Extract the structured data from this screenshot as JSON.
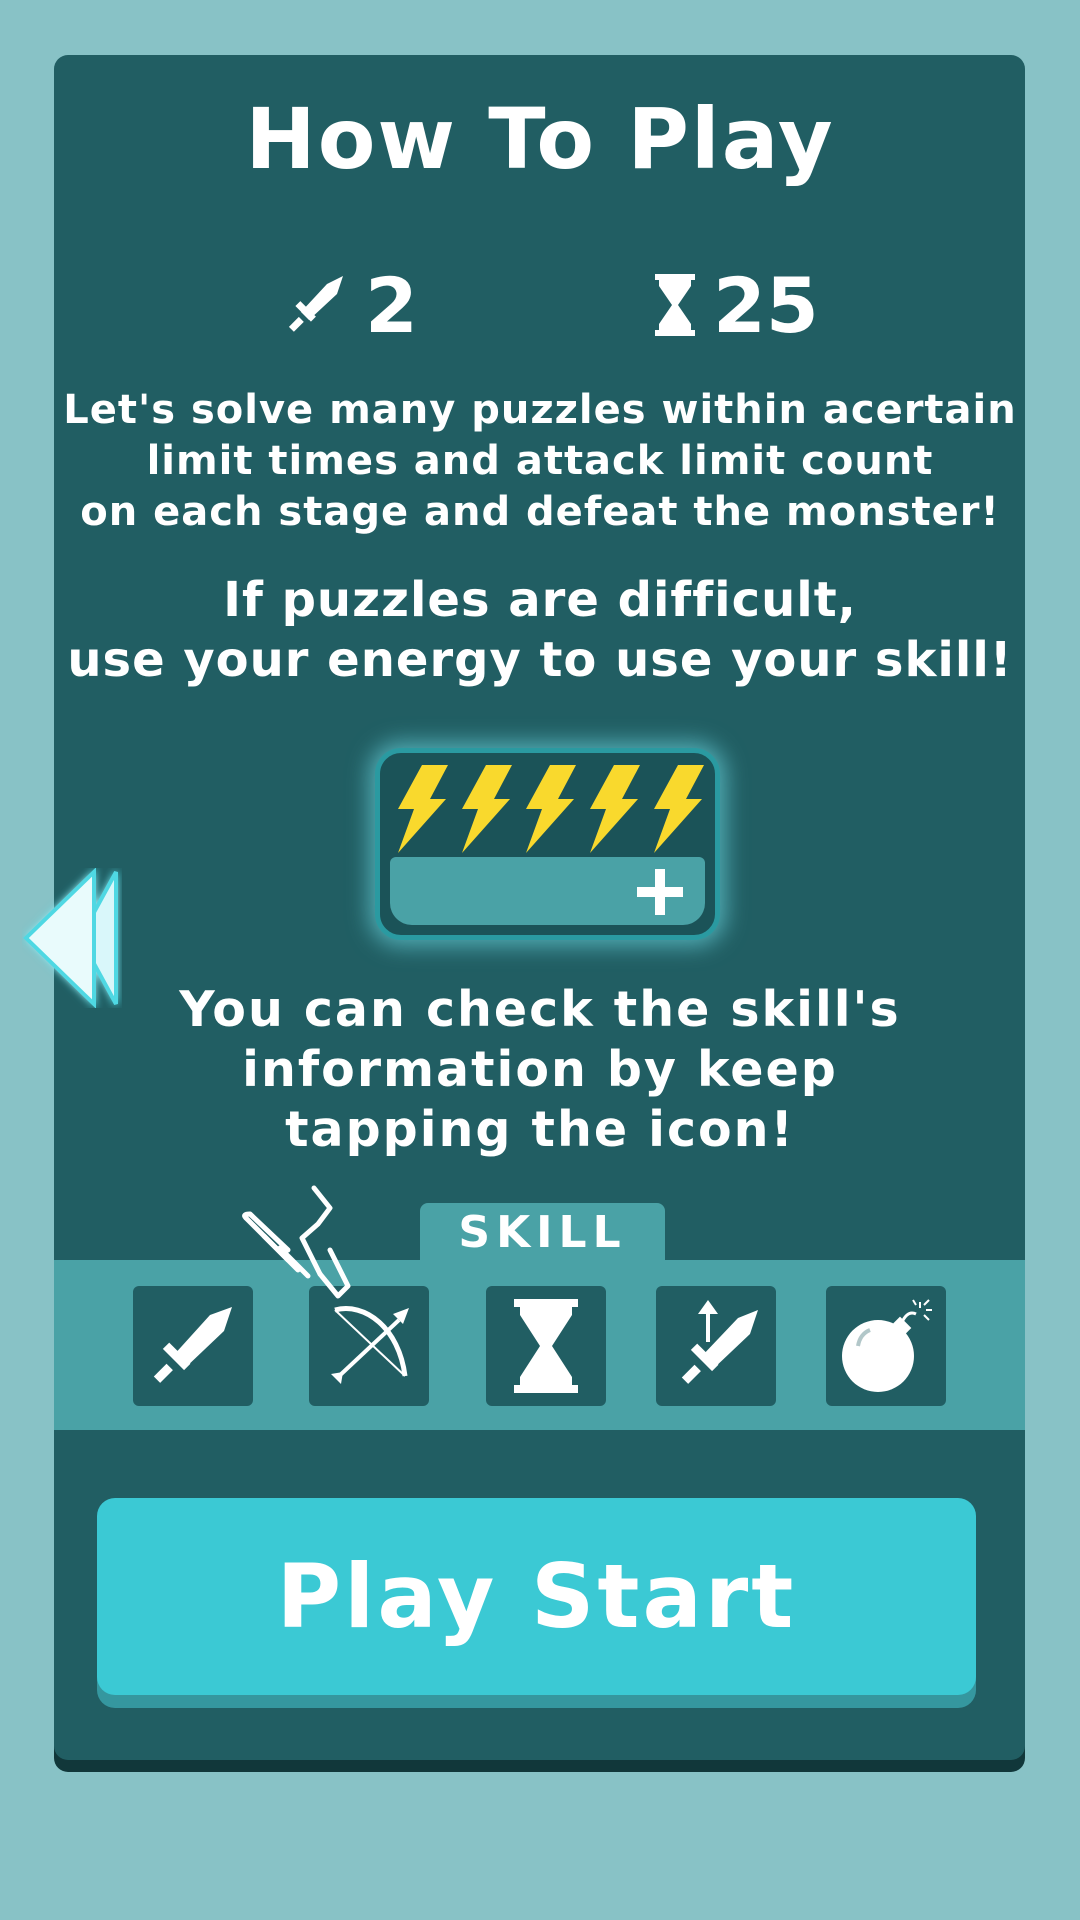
{
  "title": "How To Play",
  "stats": {
    "attack_count": "2",
    "time_limit": "25"
  },
  "text": {
    "rules_line1": "Let's solve many puzzles within acertain",
    "rules_line2": "limit times and attack limit count",
    "rules_line3": "on each stage and defeat the monster!",
    "skill_line1": "If puzzles are difficult,",
    "skill_line2": "use your energy to use your skill!",
    "info_line1": "You can check the skill's",
    "info_line2": "information by keep",
    "info_line3": "tapping the icon!"
  },
  "energy": {
    "bolts": 5,
    "plus_icon": "plus-icon"
  },
  "skill": {
    "tab_label": "SKILL",
    "icons": [
      "sword-icon",
      "bow-arrow-icon",
      "hourglass-icon",
      "sword-up-arrow-icon",
      "bomb-icon"
    ]
  },
  "buttons": {
    "play_start": "Play Start"
  },
  "colors": {
    "background": "#88c2c6",
    "panel": "#215e63",
    "accent": "#3bc9d4",
    "skill_bar": "#4aa2a6",
    "bolt": "#f9d92d"
  }
}
